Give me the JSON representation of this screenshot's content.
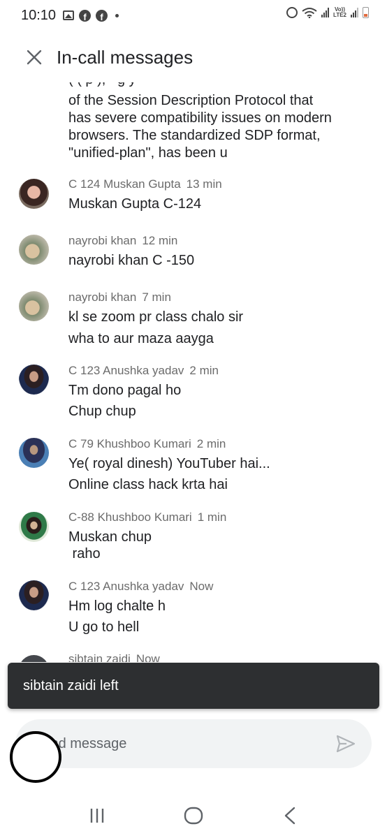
{
  "status_bar": {
    "time": "10:10",
    "lte_label_top": "Vo))",
    "lte_label_bottom": "LTE2",
    "icons": [
      "image-icon",
      "facebook-icon",
      "facebook-icon",
      "dot-icon",
      "alarm-icon",
      "wifi-icon",
      "signal-icon",
      "lte-icon",
      "signal-icon",
      "battery-icon"
    ]
  },
  "header": {
    "title": "In-call messages",
    "close_icon": "close-icon"
  },
  "partial_message": {
    "lines": [
      "of the Session Description Protocol that",
      "has severe compatibility issues on modern",
      "browsers. The standardized SDP format,",
      "\"unified-plan\", has been u"
    ]
  },
  "messages": [
    {
      "sender": "C 124 Muskan Gupta",
      "time": "13 min",
      "lines": [
        "Muskan Gupta C-124"
      ]
    },
    {
      "sender": "nayrobi khan",
      "time": "12 min",
      "lines": [
        "nayrobi khan C -150"
      ]
    },
    {
      "sender": "nayrobi khan",
      "time": "7 min",
      "lines": [
        "kl se zoom pr class chalo sir",
        "wha to aur maza aayga"
      ]
    },
    {
      "sender": "C 123 Anushka yadav",
      "time": "2 min",
      "lines": [
        "Tm dono pagal ho",
        "Chup chup"
      ]
    },
    {
      "sender": "C 79 Khushboo Kumari",
      "time": "2 min",
      "lines": [
        "Ye( royal dinesh) YouTuber hai...",
        "Online class hack krta hai"
      ]
    },
    {
      "sender": "C-88 Khushboo Kumari",
      "time": "1 min",
      "lines": [
        "Muskan chup",
        " raho"
      ]
    },
    {
      "sender": "C 123 Anushka yadav",
      "time": "Now",
      "lines": [
        "Hm log chalte h",
        "U go to hell"
      ]
    },
    {
      "sender": "sibtain zaidi",
      "time": "Now",
      "lines": []
    }
  ],
  "toast": {
    "text": "sibtain zaidi left"
  },
  "input": {
    "placeholder": "Send message",
    "send_icon": "send-icon"
  },
  "nav": {
    "recents_icon": "recents-icon",
    "home_icon": "home-icon",
    "back_icon": "back-icon"
  }
}
